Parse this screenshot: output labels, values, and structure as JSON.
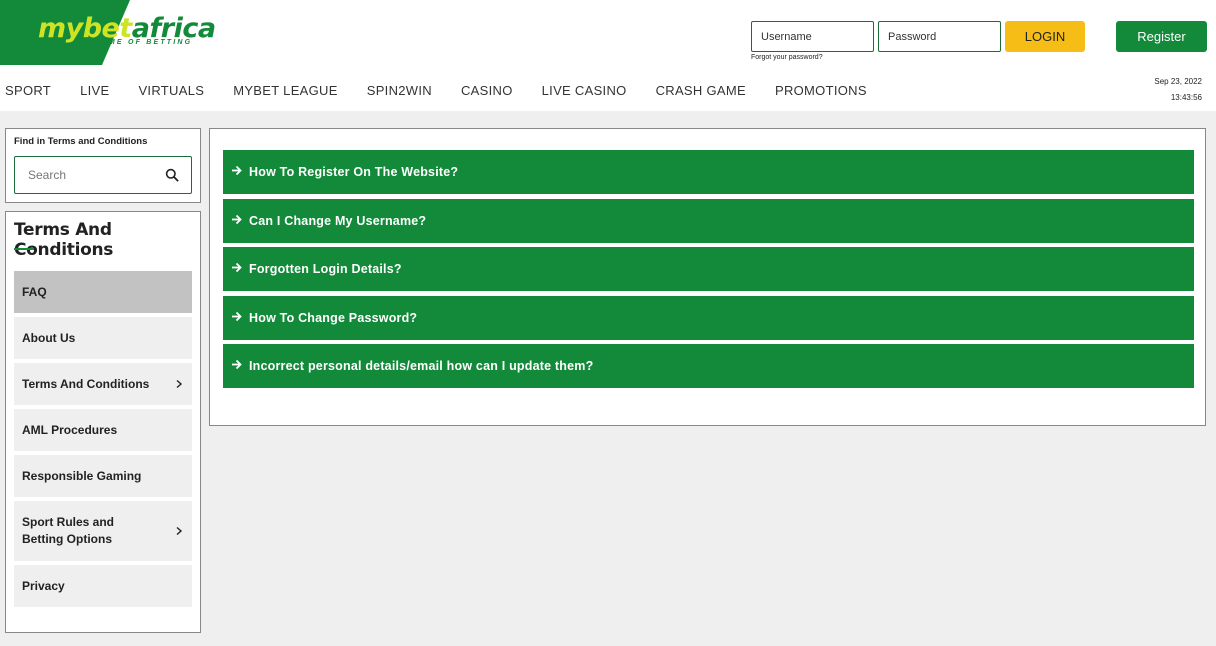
{
  "header": {
    "logo": {
      "text_main": "mybet",
      "text_brand": "africa",
      "tagline": "HOME OF BETTING"
    },
    "username_placeholder": "Username",
    "password_placeholder": "Password",
    "forgot_link": "Forgot your password?",
    "login_label": "LOGIN",
    "register_label": "Register",
    "date": "Sep 23, 2022",
    "time": "13:43:56"
  },
  "nav": {
    "items": [
      "SPORT",
      "LIVE",
      "VIRTUALS",
      "MYBET LEAGUE",
      "SPIN2WIN",
      "CASINO",
      "LIVE CASINO",
      "CRASH GAME",
      "PROMOTIONS"
    ]
  },
  "search": {
    "title": "Find in Terms and Conditions",
    "placeholder": "Search"
  },
  "sidebar": {
    "title": "Terms And Conditions",
    "items": [
      {
        "label": "FAQ"
      },
      {
        "label": "About Us"
      },
      {
        "label": "Terms And Conditions"
      },
      {
        "label": "AML Procedures"
      },
      {
        "label": "Responsible Gaming"
      },
      {
        "label": "Sport Rules and Betting Options"
      },
      {
        "label": "Privacy"
      }
    ]
  },
  "faq": {
    "questions": [
      "How To Register On The Website?",
      "Can I Change My Username?",
      "Forgotten Login Details?",
      "How To Change Password?",
      "Incorrect personal details/email how can I update them?"
    ]
  },
  "colors": {
    "brand_green": "#128a3a",
    "logo_lime": "#cfe325",
    "login_yellow": "#f6bd16"
  }
}
